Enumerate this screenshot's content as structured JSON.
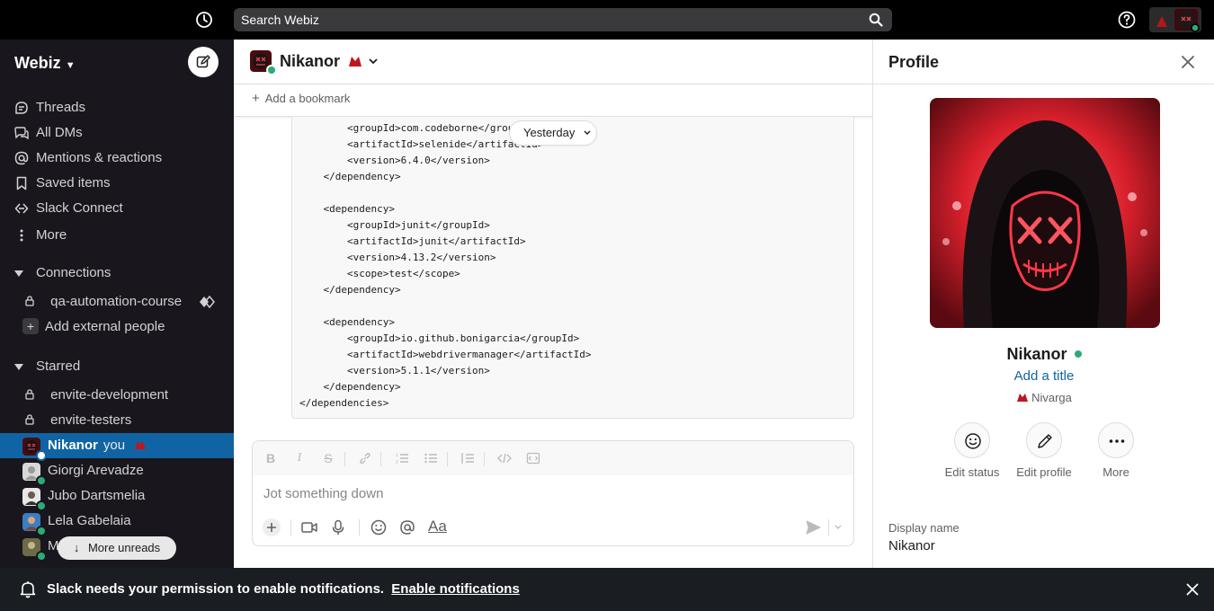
{
  "topbar": {
    "search_placeholder": "Search Webiz",
    "history_icon": "clock-icon",
    "help_icon": "question-circle-icon"
  },
  "sidebar": {
    "workspace": "Webiz",
    "nav": [
      {
        "label": "Threads",
        "icon": "threads-icon"
      },
      {
        "label": "All DMs",
        "icon": "dms-icon"
      },
      {
        "label": "Mentions & reactions",
        "icon": "at-icon"
      },
      {
        "label": "Saved items",
        "icon": "bookmark-icon"
      },
      {
        "label": "Slack Connect",
        "icon": "connect-icon"
      },
      {
        "label": "More",
        "icon": "kebab-icon"
      }
    ],
    "connections": {
      "title": "Connections",
      "channels": [
        "qa-automation-course"
      ],
      "add_label": "Add external people"
    },
    "starred": {
      "title": "Starred",
      "channels": [
        "envite-development",
        "envite-testers"
      ]
    },
    "dms": [
      {
        "name": "Nikanor",
        "you": "you",
        "active": true
      },
      {
        "name": "Giorgi Arevadze",
        "active": false
      },
      {
        "name": "Jubo Dartsmelia",
        "active": false
      },
      {
        "name": "Lela Gabelaia",
        "active": false
      },
      {
        "name": "M",
        "active": false
      }
    ],
    "more_unreads": "More unreads"
  },
  "channel": {
    "name": "Nikanor",
    "bookmark_label": "Add a bookmark",
    "date_divider": "Yesterday",
    "code_lines": [
      "        <groupId>com.codeborne</groupId>",
      "        <artifactId>selenide</artifactId>",
      "        <version>6.4.0</version>",
      "    </dependency>",
      "",
      "    <dependency>",
      "        <groupId>junit</groupId>",
      "        <artifactId>junit</artifactId>",
      "        <version>4.13.2</version>",
      "        <scope>test</scope>",
      "    </dependency>",
      "",
      "    <dependency>",
      "        <groupId>io.github.bonigarcia</groupId>",
      "        <artifactId>webdrivermanager</artifactId>",
      "        <version>5.1.1</version>",
      "    </dependency>",
      "</dependencies>"
    ],
    "composer_placeholder": "Jot something down"
  },
  "profile": {
    "header": "Profile",
    "name": "Nikanor",
    "add_title": "Add a title",
    "status_text": "Nivarga",
    "actions": [
      {
        "label": "Edit status",
        "icon": "smiley-icon"
      },
      {
        "label": "Edit profile",
        "icon": "pencil-icon"
      },
      {
        "label": "More",
        "icon": "ellipsis-icon"
      }
    ],
    "display_name_label": "Display name",
    "display_name_value": "Nikanor"
  },
  "notification": {
    "message": "Slack needs your permission to enable notifications.",
    "link": "Enable notifications"
  },
  "colors": {
    "sidebar_bg": "#19171d",
    "active_item": "#1164a3",
    "presence_green": "#2bac76",
    "link_blue": "#1264a3",
    "topbar_bg": "#000000"
  }
}
